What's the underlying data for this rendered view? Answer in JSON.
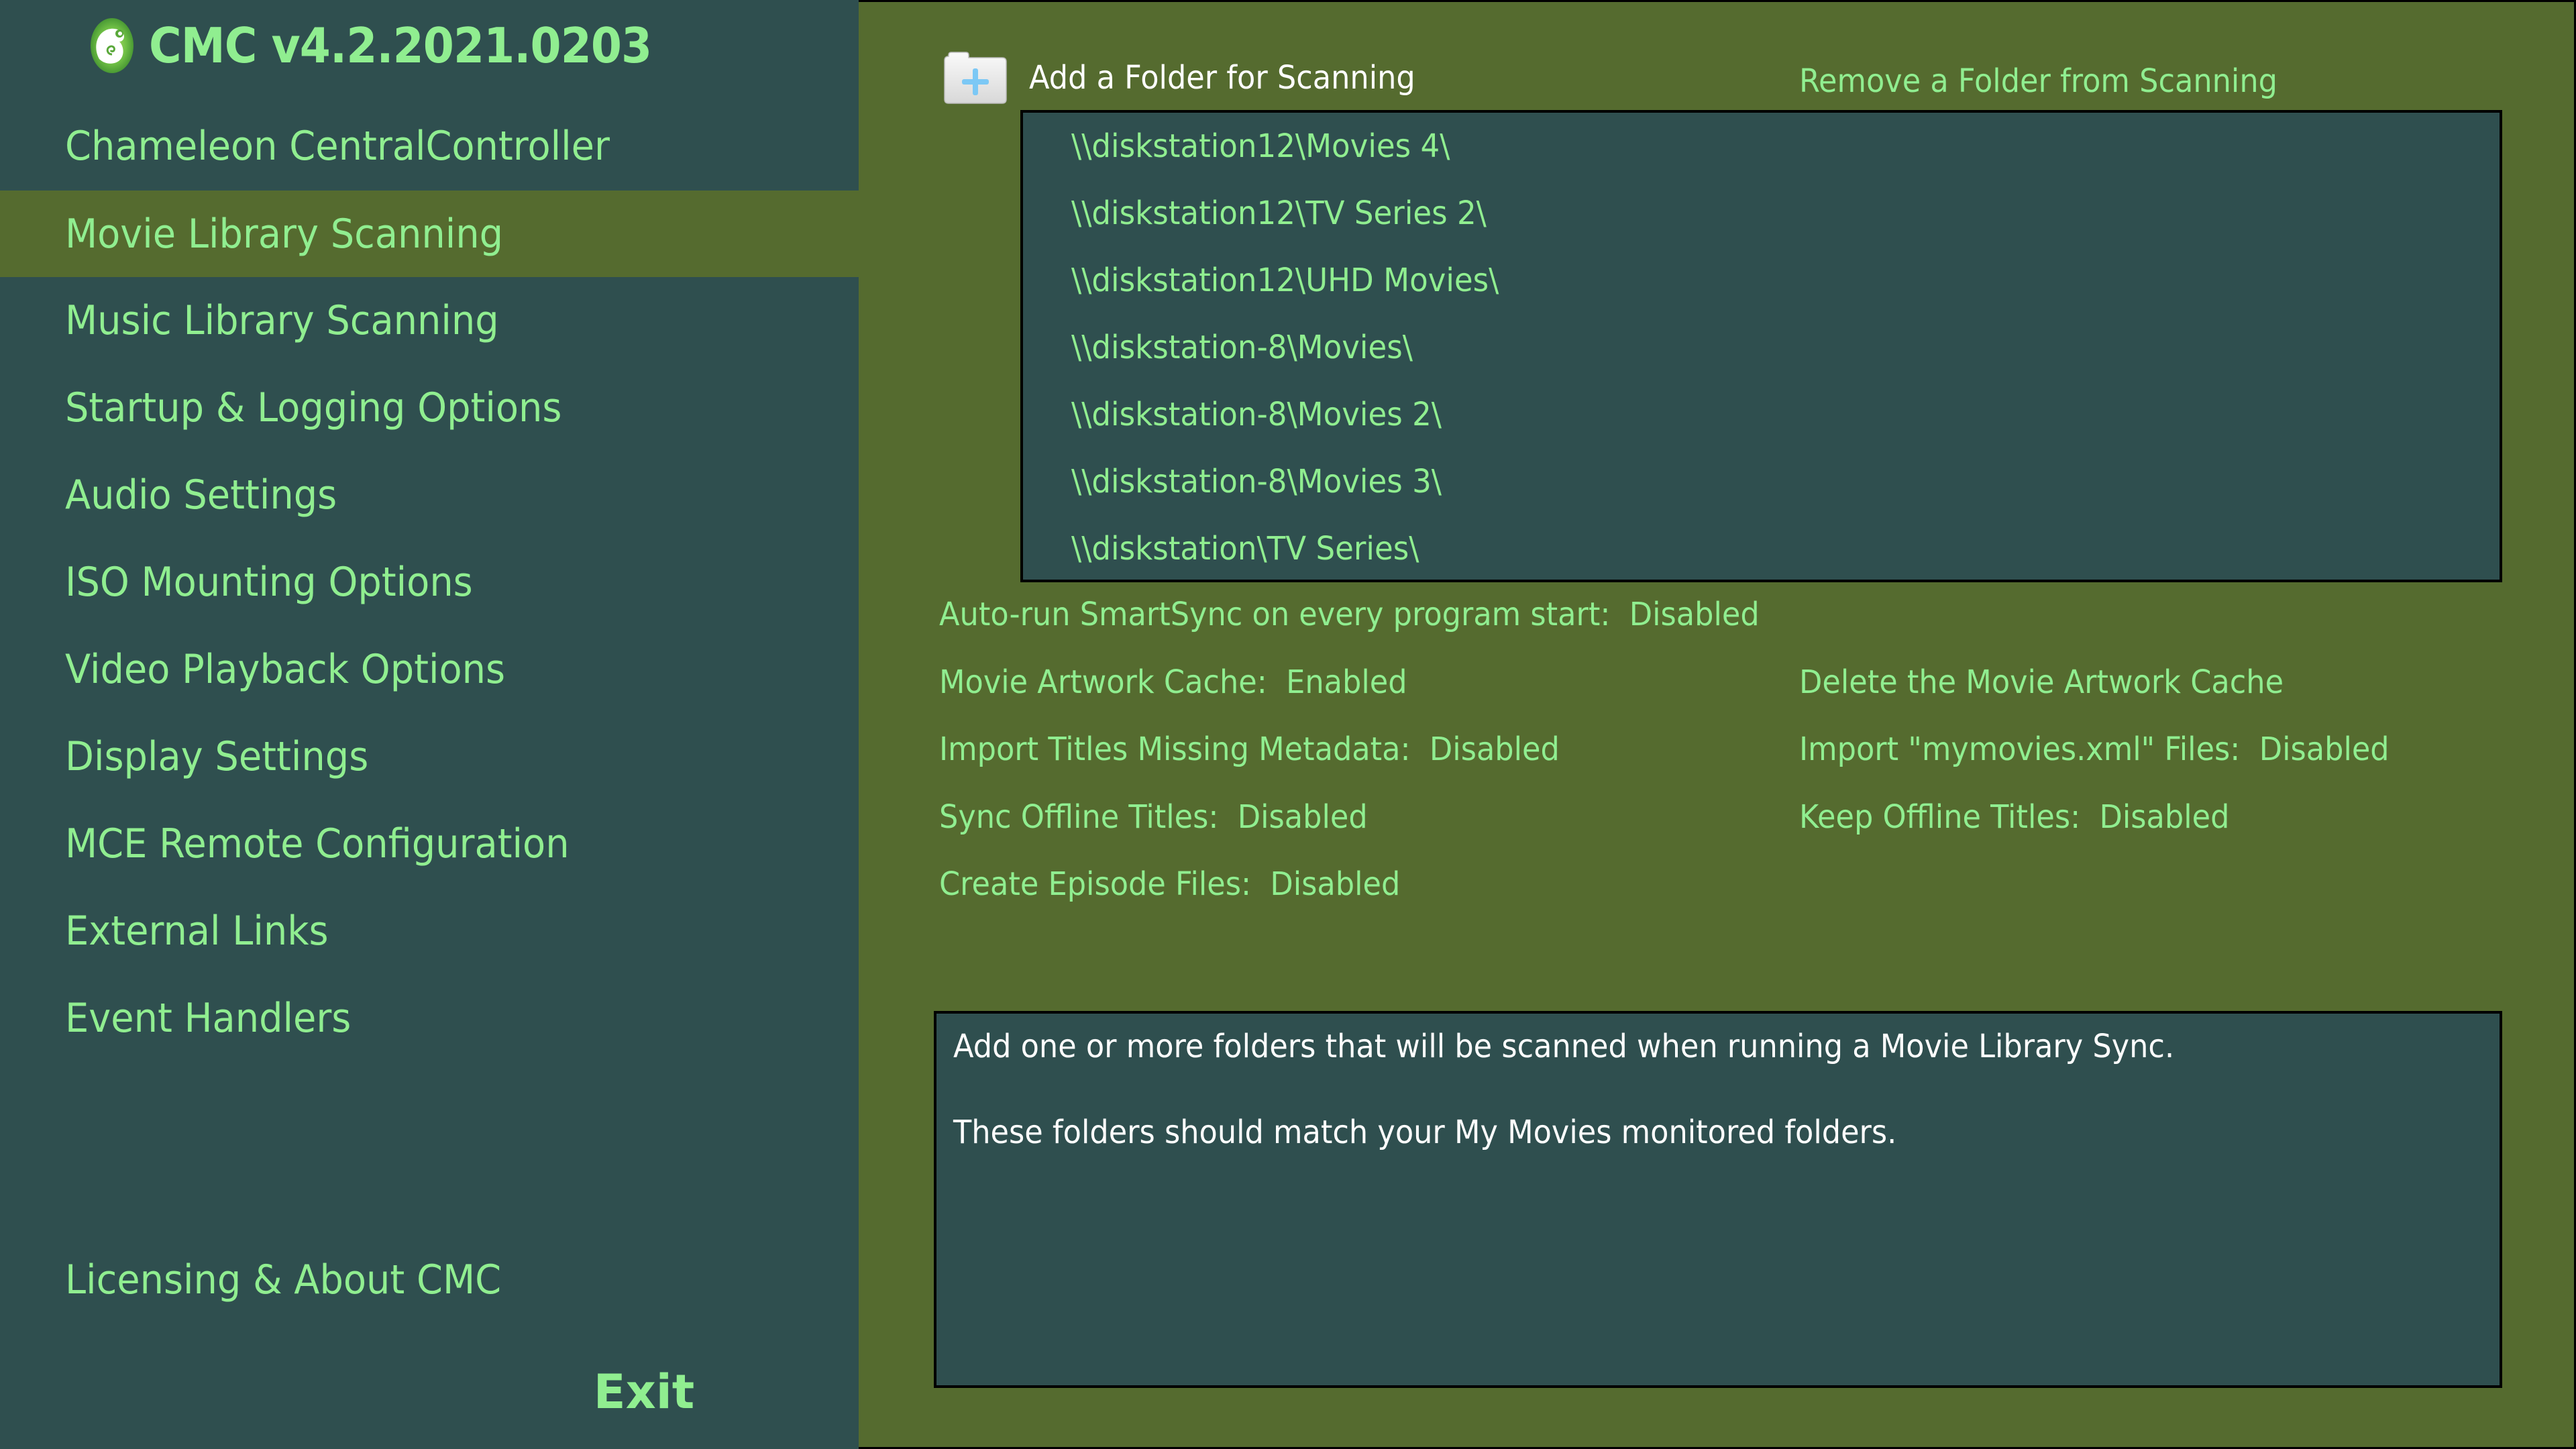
{
  "app": {
    "title": "CMC v4.2.2021.0203",
    "logo_icon": "chameleon-logo-icon"
  },
  "colors": {
    "sidebar_bg": "#2F4F4F",
    "main_bg": "#556B2F",
    "selected_bg": "#556B2F",
    "accent_text": "#90EE90",
    "white_text": "#FFFFFF",
    "border": "#000000"
  },
  "sidebar": {
    "items": [
      {
        "label": "Chameleon CentralController",
        "selected": false
      },
      {
        "label": "Movie Library Scanning",
        "selected": true
      },
      {
        "label": "Music Library Scanning",
        "selected": false
      },
      {
        "label": "Startup & Logging Options",
        "selected": false
      },
      {
        "label": "Audio Settings",
        "selected": false
      },
      {
        "label": "ISO Mounting Options",
        "selected": false
      },
      {
        "label": "Video Playback Options",
        "selected": false
      },
      {
        "label": "Display Settings",
        "selected": false
      },
      {
        "label": "MCE Remote Configuration",
        "selected": false
      },
      {
        "label": "External Links",
        "selected": false
      },
      {
        "label": "Event Handlers",
        "selected": false
      }
    ],
    "licensing_label": "Licensing & About CMC",
    "exit_label": "Exit"
  },
  "main": {
    "add_folder": {
      "label": "Add a Folder for Scanning",
      "icon": "folder-add-icon"
    },
    "remove_folder_label": "Remove a Folder from Scanning",
    "folders": [
      "\\\\diskstation12\\Movies 4\\",
      "\\\\diskstation12\\TV Series 2\\",
      "\\\\diskstation12\\UHD Movies\\",
      "\\\\diskstation-8\\Movies\\",
      "\\\\diskstation-8\\Movies 2\\",
      "\\\\diskstation-8\\Movies 3\\",
      "\\\\diskstation\\TV Series\\"
    ],
    "settings_left": [
      {
        "label": "Auto-run SmartSync on every program start:",
        "value": "Disabled"
      },
      {
        "label": "Movie Artwork Cache:",
        "value": "Enabled"
      },
      {
        "label": "Import Titles Missing Metadata:",
        "value": "Disabled"
      },
      {
        "label": "Sync Offline Titles:",
        "value": "Disabled"
      },
      {
        "label": "Create Episode Files:",
        "value": "Disabled"
      }
    ],
    "delete_cache_label": "Delete the Movie Artwork Cache",
    "settings_right": [
      {
        "label": "Import \"mymovies.xml\" Files:",
        "value": "Disabled"
      },
      {
        "label": "Keep Offline Titles:",
        "value": "Disabled"
      }
    ],
    "description": [
      "Add one or more folders that will be scanned when running a Movie Library Sync.",
      "These folders should match your My Movies monitored folders."
    ]
  }
}
